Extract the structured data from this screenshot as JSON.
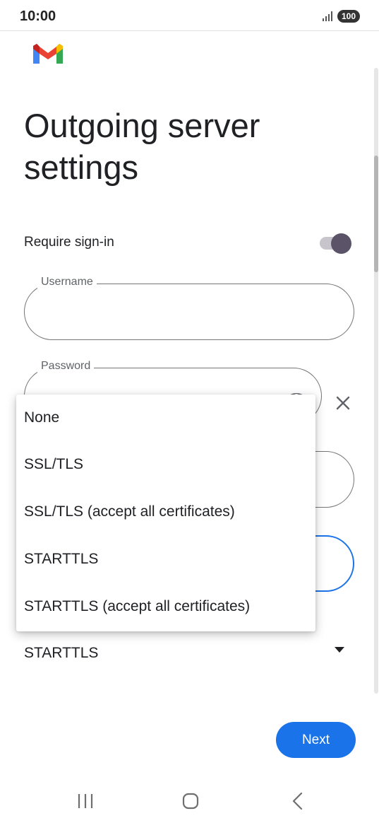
{
  "status_bar": {
    "time": "10:00",
    "battery": "100",
    "icons": [
      "signal-icon",
      "battery-icon"
    ]
  },
  "header": {
    "logo": "gmail-logo-icon"
  },
  "page": {
    "title": "Outgoing server settings"
  },
  "sign_in": {
    "label": "Require sign-in",
    "enabled": true
  },
  "fields": {
    "username": {
      "label": "Username",
      "value": ""
    },
    "password": {
      "label": "Password",
      "value": ""
    }
  },
  "security": {
    "selected": "STARTTLS"
  },
  "dropdown": {
    "options": [
      "None",
      "SSL/TLS",
      "SSL/TLS (accept all certificates)",
      "STARTTLS",
      "STARTTLS (accept all certificates)"
    ]
  },
  "actions": {
    "next_label": "Next"
  },
  "colors": {
    "accent": "#1a73e8",
    "toggle_knob": "#5b5468",
    "toggle_track": "#c7c4cc"
  },
  "nav": {
    "icons": [
      "recent-apps-icon",
      "home-icon",
      "back-icon"
    ]
  }
}
